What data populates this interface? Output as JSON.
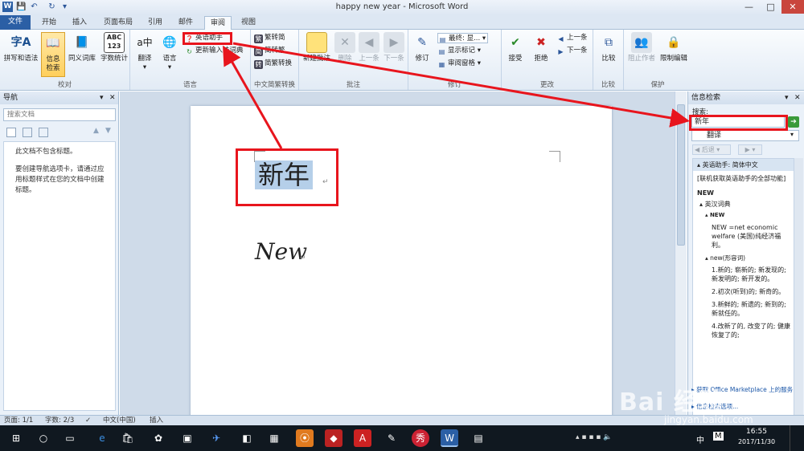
{
  "window": {
    "title": "happy new year - Microsoft Word",
    "min": "—",
    "max": "□",
    "close": "✕"
  },
  "qat": {
    "save": "💾",
    "undo": "↶",
    "redo": "↻",
    "custom": "▾"
  },
  "tabs": [
    {
      "label": "文件"
    },
    {
      "label": "开始"
    },
    {
      "label": "插入"
    },
    {
      "label": "页面布局"
    },
    {
      "label": "引用"
    },
    {
      "label": "邮件"
    },
    {
      "label": "审阅"
    },
    {
      "label": "视图"
    }
  ],
  "ribbon": {
    "proofing": {
      "group": "校对",
      "spelling": "拼写和语法",
      "research1": "信息",
      "research2": "检索",
      "thesaurus": "同义词库",
      "wordcount": "字数统计",
      "wordcount_icon": "ABC\n123"
    },
    "language": {
      "group": "语言",
      "translate": "翻译",
      "language": "语言",
      "english_assistant": "英语助手",
      "update_dict": "更新输入法词典"
    },
    "chinese": {
      "group": "中文简繁转换",
      "trad_to_simp": "繁转简",
      "simp_to_trad": "简转繁",
      "convert": "简繁转换"
    },
    "comments": {
      "group": "批注",
      "new": "新建批注",
      "delete": "删除",
      "previous": "上一条",
      "next": "下一条"
    },
    "tracking": {
      "group": "修订",
      "track": "修订",
      "final": "最终: 显...",
      "markup": "显示标记",
      "pane": "审阅窗格"
    },
    "changes": {
      "group": "更改",
      "accept": "接受",
      "reject": "拒绝",
      "previous": "上一条",
      "next": "下一条"
    },
    "compare": {
      "group": "比较",
      "compare": "比较"
    },
    "protect": {
      "group": "保护",
      "block": "阻止作者",
      "restrict": "限制编辑"
    }
  },
  "nav": {
    "title": "导航",
    "search_placeholder": "搜索文档",
    "line1": "此文档不包含标题。",
    "line2": "要创建导航选项卡，请通过应用标题样式在您的文档中创建标题。"
  },
  "doc": {
    "line1": "新年",
    "line2": "New",
    "mark": "↵"
  },
  "research": {
    "title": "信息检索",
    "search_label": "搜索:",
    "query": "新年",
    "source": "翻译",
    "back": "后退",
    "result_head": "英语助手: 简体中文",
    "online_note": "[联机获取英语助手的全部功能]",
    "word": "NEW",
    "dict": "英汉词典",
    "entry_head": "NEW",
    "entry_def": "NEW =net economic welfare (美国)纯经济福利。",
    "pos": "new(形容词)",
    "defs": [
      "1.新的; 崭新的; 新发现的; 新发明的; 新开发的。",
      "2.初次(听到)的; 新奇的。",
      "3.新鲜的; 新遗的; 新到的; 新就任的。",
      "4.改新了的, 改变了的; 健康恢复了的;"
    ],
    "footer1": "获取 Office Marketplace 上的服务",
    "footer2": "信息检索选项..."
  },
  "status": {
    "page": "页面: 1/1",
    "words": "字数: 2/3",
    "lang": "中文(中国)",
    "mode": "插入"
  },
  "taskbar": {
    "time": "16:55",
    "date": "2017/11/30",
    "ime": "中",
    "ime2": "M"
  },
  "watermark": {
    "brand": "Bai 经验",
    "url": "jingyan.baidu.com"
  },
  "colors": {
    "accent": "#2b5fa5",
    "annotation": "#e8151d",
    "selection": "#b5cfe9"
  }
}
